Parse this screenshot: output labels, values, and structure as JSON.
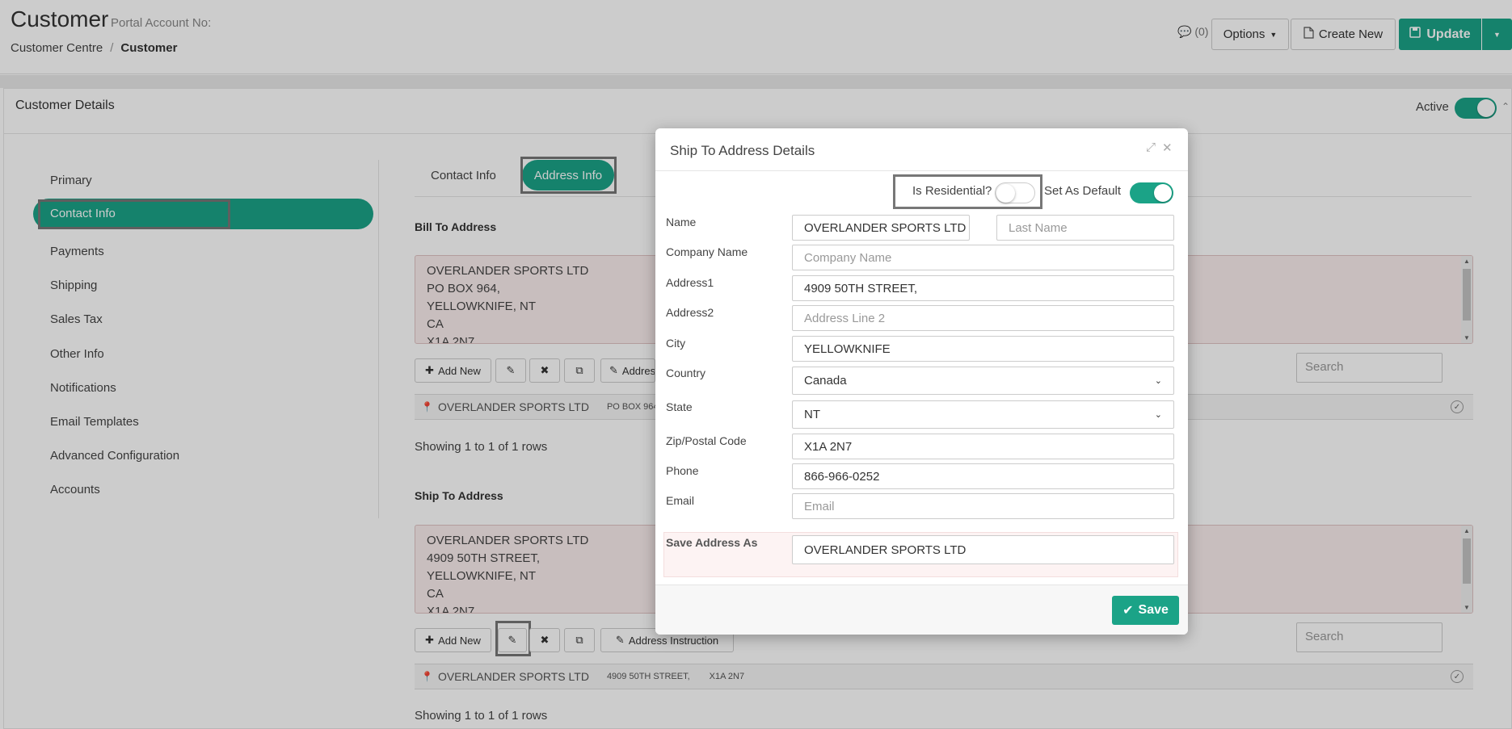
{
  "header": {
    "title": "Customer",
    "portal_label": "Portal Account No:",
    "breadcrumb": [
      "Customer Centre",
      "Customer"
    ],
    "comments_count": "(0)",
    "options_label": "Options",
    "create_new_label": "Create New",
    "update_label": "Update"
  },
  "card": {
    "title": "Customer Details",
    "active_label": "Active",
    "active_on": true
  },
  "sidebar": {
    "items": [
      {
        "label": "Primary"
      },
      {
        "label": "Contact Info",
        "active": true
      },
      {
        "label": "Payments"
      },
      {
        "label": "Shipping"
      },
      {
        "label": "Sales Tax"
      },
      {
        "label": "Other Info"
      },
      {
        "label": "Notifications"
      },
      {
        "label": "Email Templates"
      },
      {
        "label": "Advanced Configuration"
      },
      {
        "label": "Accounts"
      }
    ]
  },
  "tabs": [
    {
      "label": "Contact Info"
    },
    {
      "label": "Address Info",
      "active": true
    }
  ],
  "bill_to": {
    "title": "Bill To Address",
    "lines": [
      "OVERLANDER SPORTS LTD",
      "PO BOX 964,",
      "YELLOWKNIFE, NT",
      "CA",
      "X1A 2N7"
    ],
    "toolbar": {
      "add_new": "Add New",
      "address_instruction": "Address Instruction"
    },
    "search_placeholder": "Search",
    "row": {
      "name": "OVERLANDER SPORTS LTD",
      "addr1": "PO BOX 964,"
    },
    "showing": "Showing 1 to 1 of 1 rows"
  },
  "ship_to": {
    "title": "Ship To Address",
    "lines": [
      "OVERLANDER SPORTS LTD",
      "4909 50TH STREET,",
      "YELLOWKNIFE, NT",
      "CA",
      "X1A 2N7"
    ],
    "toolbar": {
      "add_new": "Add New",
      "address_instruction": "Address Instruction"
    },
    "search_placeholder": "Search",
    "row": {
      "name": "OVERLANDER SPORTS LTD",
      "addr1": "4909 50TH STREET,",
      "zip": "X1A 2N7"
    },
    "showing": "Showing 1 to 1 of 1 rows"
  },
  "modal": {
    "title": "Ship To Address Details",
    "is_residential_label": "Is Residential?",
    "is_residential": false,
    "set_default_label": "Set As Default",
    "set_default": true,
    "fields": {
      "name_label": "Name",
      "first_name": "OVERLANDER SPORTS LTD",
      "last_name_placeholder": "Last Name",
      "company_label": "Company Name",
      "company_placeholder": "Company Name",
      "address1_label": "Address1",
      "address1": "4909 50TH STREET,",
      "address2_label": "Address2",
      "address2_placeholder": "Address Line 2",
      "city_label": "City",
      "city": "YELLOWKNIFE",
      "country_label": "Country",
      "country": "Canada",
      "state_label": "State",
      "state": "NT",
      "zip_label": "Zip/Postal Code",
      "zip": "X1A 2N7",
      "phone_label": "Phone",
      "phone": "866-966-0252",
      "email_label": "Email",
      "email_placeholder": "Email",
      "save_as_label": "Save Address As",
      "save_as": "OVERLANDER SPORTS LTD"
    },
    "save_label": "Save"
  },
  "colors": {
    "accent": "#1ba387"
  }
}
